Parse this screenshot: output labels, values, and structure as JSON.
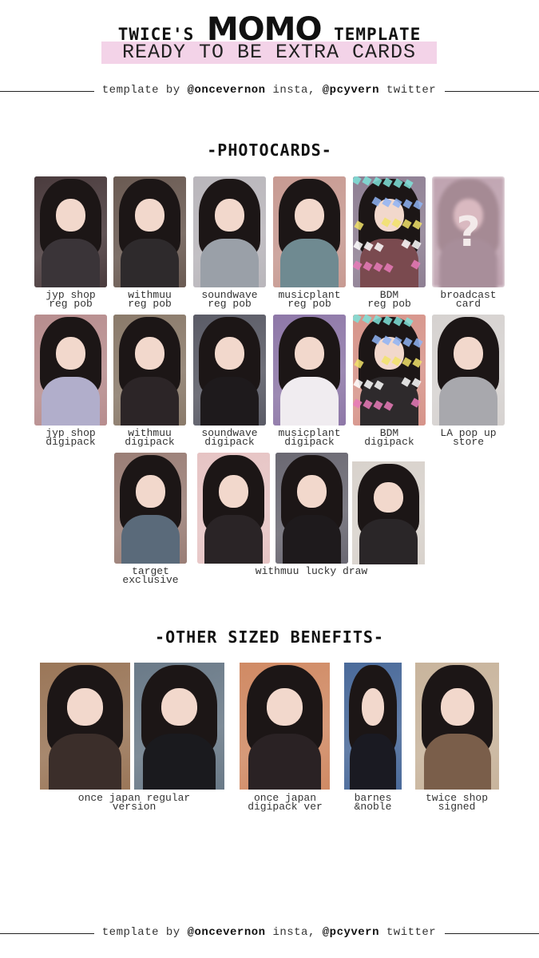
{
  "header": {
    "title_prefix": "TWICE'S",
    "title_name": "MOMO",
    "title_suffix": "TEMPLATE",
    "subtitle": "READY TO BE EXTRA CARDS"
  },
  "credits": {
    "prefix": "template by",
    "insta_handle": "@oncevernon",
    "insta_label": "insta,",
    "twitter_handle": "@pcyvern",
    "twitter_label": "twitter"
  },
  "sections": {
    "photocards_title": "-PHOTOCARDS-",
    "other_title": "-OTHER SIZED BENEFITS-"
  },
  "photocards": {
    "row1": [
      {
        "label": "jyp shop\nreg pob",
        "bg": "#4a3b3d",
        "body": "#3a3438"
      },
      {
        "label": "withmuu\nreg pob",
        "bg": "#6a5a52",
        "body": "#2e2a2c"
      },
      {
        "label": "soundwave\nreg pob",
        "bg": "#b9b6bb",
        "body": "#9aa0a8"
      },
      {
        "label": "musicplant\nreg pob",
        "bg": "#c79a92",
        "body": "#6f8a91"
      },
      {
        "label": "BDM\nreg pob",
        "bg": "#8e7f93",
        "body": "#7a4a4f"
      },
      {
        "label": "broadcast\ncard",
        "bg": "#bfa3b0",
        "body": "#a88e9a"
      }
    ],
    "broadcast_mark": "?",
    "row2": [
      {
        "label": "jyp shop\ndigipack",
        "bg": "#b78d8e",
        "body": "#b1aecb"
      },
      {
        "label": "withmuu\ndigipack",
        "bg": "#8a7a6a",
        "body": "#2c2527"
      },
      {
        "label": "soundwave\ndigipack",
        "bg": "#5a5b66",
        "body": "#1e1a1c"
      },
      {
        "label": "musicplant\ndigipack",
        "bg": "#8e78a8",
        "body": "#f0ecf0"
      },
      {
        "label": "BDM\ndigipack",
        "bg": "#d6948a",
        "body": "#2e2a2c"
      },
      {
        "label": "LA pop up\nstore",
        "bg": "#d6d2d0",
        "body": "#a8a8ad"
      }
    ],
    "row3": [
      {
        "label": "target\nexclusive",
        "bg": "#9a7e76",
        "body": "#5a6a7a"
      },
      {
        "label": "",
        "bg": "#e6c4c4",
        "body": "#2a2426"
      },
      {
        "label": "",
        "bg": "#6a6872",
        "body": "#1e1a1c"
      },
      {
        "label": "",
        "bg": "#d8d2cc",
        "body": "#2a2628"
      }
    ],
    "lucky_draw_label": "withmuu lucky draw"
  },
  "other_benefits": {
    "cards": [
      {
        "bg": "#9a7658",
        "body": "#3b2e2a"
      },
      {
        "bg": "#6a7a88",
        "body": "#1a1a1e"
      },
      {
        "bg": "#d08a64",
        "body": "#2a2224"
      },
      {
        "bg": "#4a6a9a",
        "body": "#1a1a22"
      },
      {
        "bg": "#c8b49c",
        "body": "#7a5e4a"
      }
    ],
    "labels": {
      "regular": "once japan regular\nversion",
      "digipack": "once japan\ndigipack ver",
      "barnes": "barnes\n&noble",
      "twice_shop": "twice shop\nsigned"
    }
  },
  "colors": {
    "subtitle_highlight": "#f3d3e8",
    "background": "#ffffff",
    "text": "#222222"
  }
}
